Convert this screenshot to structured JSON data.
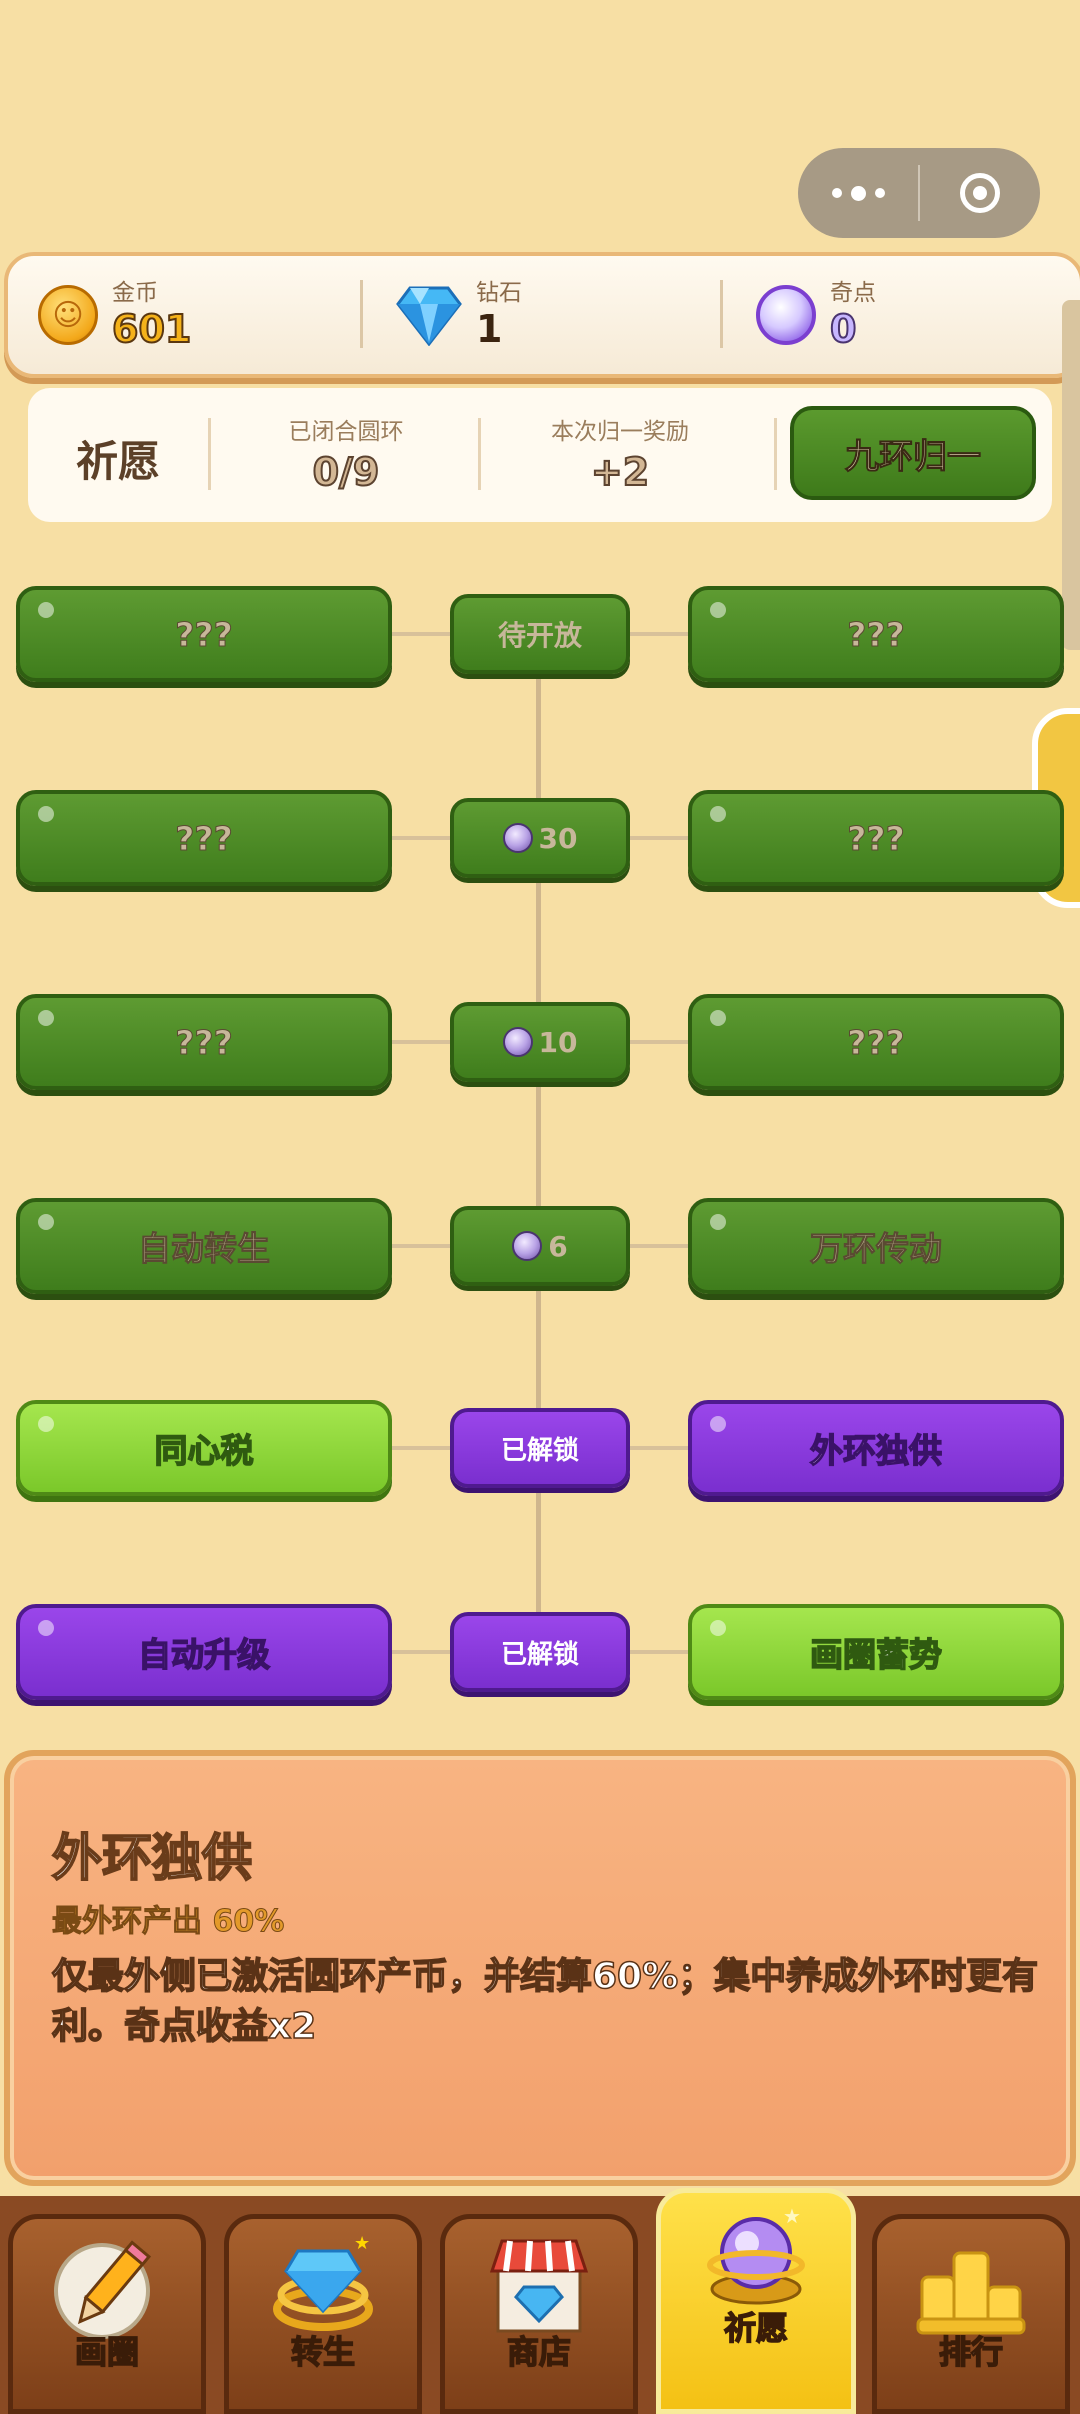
{
  "currency": {
    "gold": {
      "label": "金币",
      "value": "601",
      "icon": "gold-coin-icon"
    },
    "diamond": {
      "label": "钻石",
      "value": "1",
      "icon": "diamond-icon"
    },
    "odd_points": {
      "label": "奇点",
      "value": "0",
      "icon": "purple-orb-icon"
    }
  },
  "wish": {
    "title": "祈愿",
    "closed_rings": {
      "label": "已闭合圆环",
      "value": "0/9"
    },
    "reward": {
      "label": "本次归一奖励",
      "value": "+2"
    },
    "unify_button": "九环归一"
  },
  "tree": {
    "rows": [
      {
        "left": "???",
        "center": "待开放",
        "right": "???",
        "left_state": "locked",
        "right_state": "locked",
        "center_state": "locked"
      },
      {
        "left": "???",
        "center": "30",
        "right": "???",
        "left_state": "locked",
        "right_state": "locked",
        "center_state": "cost"
      },
      {
        "left": "???",
        "center": "10",
        "right": "???",
        "left_state": "locked",
        "right_state": "locked",
        "center_state": "cost"
      },
      {
        "left": "自动转生",
        "center": "6",
        "right": "万环传动",
        "left_state": "locked",
        "right_state": "locked",
        "center_state": "cost"
      },
      {
        "left": "同心税",
        "center": "已解锁",
        "right": "外环独供",
        "left_state": "green",
        "right_state": "purple",
        "center_state": "unlocked"
      },
      {
        "left": "自动升级",
        "center": "已解锁",
        "right": "画圈蓄势",
        "left_state": "purple",
        "right_state": "green",
        "center_state": "unlocked"
      }
    ]
  },
  "detail": {
    "title": "外环独供",
    "subtitle": "最外环产出 60%",
    "body": "仅最外侧已激活圆环产币，并结算60%；集中养成外环时更有利。奇点收益x2"
  },
  "nav": {
    "tabs": [
      {
        "label": "画圈",
        "icon": "pencil-icon"
      },
      {
        "label": "转生",
        "icon": "diamond-ring-icon"
      },
      {
        "label": "商店",
        "icon": "shop-icon"
      },
      {
        "label": "祈愿",
        "icon": "wish-orb-icon"
      },
      {
        "label": "排行",
        "icon": "podium-icon"
      }
    ],
    "active": "祈愿"
  }
}
